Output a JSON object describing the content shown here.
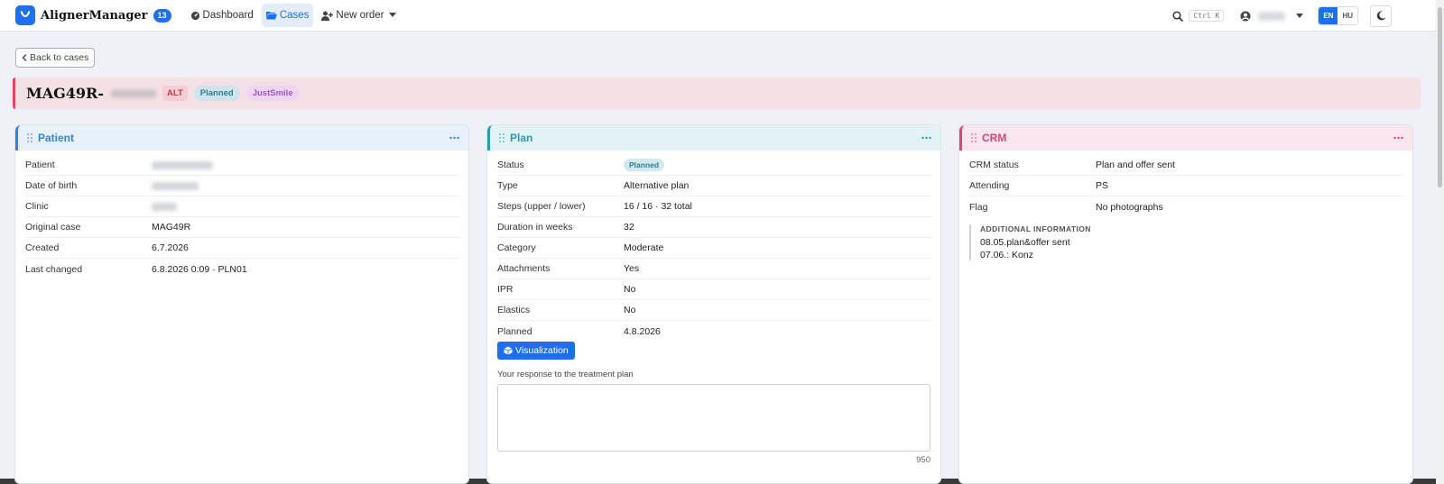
{
  "navbar": {
    "brand_name": "AlignerManager",
    "brand_badge": "13",
    "items": [
      {
        "label": "Dashboard"
      },
      {
        "label": "Cases"
      },
      {
        "label": "New order"
      }
    ],
    "search_shortcut": "Ctrl K",
    "languages": [
      "EN",
      "HU"
    ],
    "active_language": "EN"
  },
  "back_button": "Back to cases",
  "case": {
    "id": "MAG49R-",
    "tags": [
      "ALT",
      "Planned",
      "JustSmile"
    ]
  },
  "patient_card": {
    "title": "Patient",
    "rows": [
      {
        "label": "Patient",
        "value": ""
      },
      {
        "label": "Date of birth",
        "value": ""
      },
      {
        "label": "Clinic",
        "value": ""
      },
      {
        "label": "Original case",
        "value": "MAG49R"
      },
      {
        "label": "Created",
        "value": "6.7.2026"
      },
      {
        "label": "Last changed",
        "value": "6.8.2026 0:09 · PLN01"
      }
    ]
  },
  "plan_card": {
    "title": "Plan",
    "status_label": "Status",
    "status_value": "Planned",
    "rows": [
      {
        "label": "Type",
        "value": "Alternative plan"
      },
      {
        "label": "Steps (upper / lower)",
        "value": "16 / 16 · 32 total"
      },
      {
        "label": "Duration in weeks",
        "value": "32"
      },
      {
        "label": "Category",
        "value": "Moderate"
      },
      {
        "label": "Attachments",
        "value": "Yes"
      },
      {
        "label": "IPR",
        "value": "No"
      },
      {
        "label": "Elastics",
        "value": "No"
      },
      {
        "label": "Planned",
        "value": "4.8.2026"
      }
    ],
    "visualization_button": "Visualization",
    "response_label": "Your response to the treatment plan",
    "response_value": "",
    "char_counter": "950"
  },
  "crm_card": {
    "title": "CRM",
    "rows": [
      {
        "label": "CRM status",
        "value": "Plan and offer sent"
      },
      {
        "label": "Attending",
        "value": "PS"
      },
      {
        "label": "Flag",
        "value": "No photographs"
      }
    ],
    "additional_info_header": "ADDITIONAL INFORMATION",
    "additional_info_lines": [
      "08.05.plan&offer sent",
      "07.06.: Konz"
    ]
  },
  "colors": {
    "accent": "#1e6ff0",
    "patient_accent": "#2f86d6",
    "plan_accent": "#2a9bb0",
    "crm_accent": "#d6457d",
    "case_header_bar": "#e04a5f"
  },
  "icons": {
    "brand": "aligner-logo-icon",
    "dashboard": "gauge-icon",
    "cases": "folder-open-icon",
    "new_order": "user-plus-icon",
    "search": "search-icon",
    "user": "user-circle-icon",
    "theme": "moon-icon",
    "back": "chevron-left-icon",
    "drag": "drag-handle-icon",
    "more": "more-dots-icon",
    "visualization": "cube-icon"
  }
}
